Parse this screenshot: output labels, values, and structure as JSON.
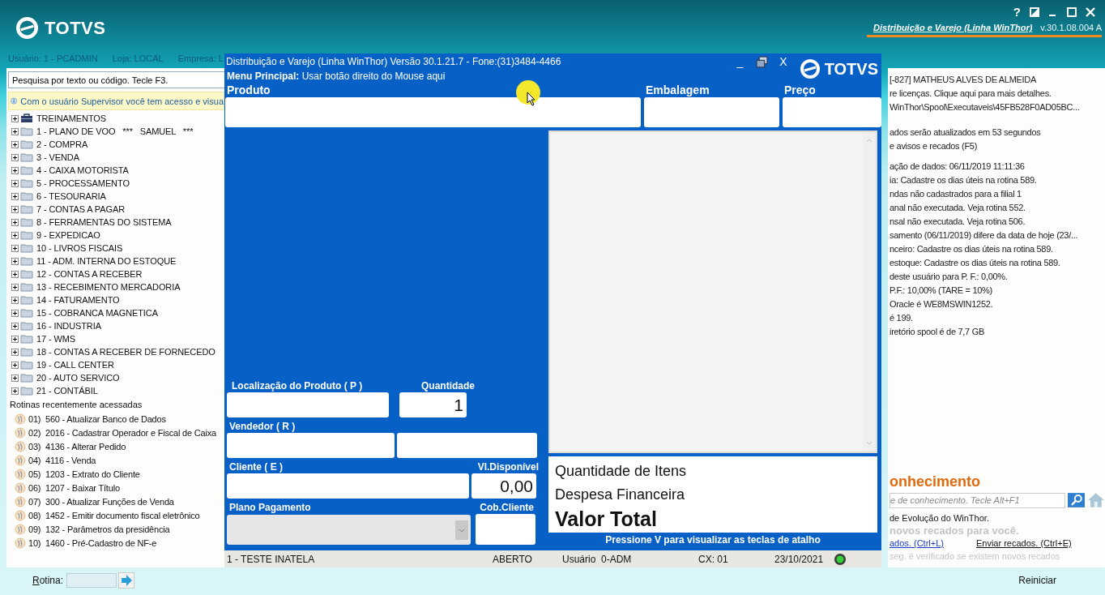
{
  "app_header": {
    "logo": "TOTVS",
    "help": "?",
    "product_link": "Distribuição e Varejo (Linha WinThor)",
    "version": "v.30.1.08.004 A"
  },
  "session_bar": [
    "Usuário: 1 - PCADMIN",
    "Loja: LOCAL",
    "Empresa: L"
  ],
  "menu_panel": {
    "search": {
      "placeholder": "Pesquisa por texto ou código. Tecle F3."
    },
    "notice": "Com o usuário Supervisor você tem acesso e visua",
    "tree": [
      {
        "label": "TREINAMENTOS",
        "kind": "briefcase",
        "expanded": false
      },
      {
        "label": "1 - PLANO DE VOO   ***   SAMUEL   ***",
        "kind": "folder",
        "expanded": false
      },
      {
        "label": "2 - COMPRA",
        "kind": "folder",
        "expanded": false
      },
      {
        "label": "3 - VENDA",
        "kind": "folder",
        "expanded": false
      },
      {
        "label": "4 - CAIXA MOTORISTA",
        "kind": "folder",
        "expanded": false
      },
      {
        "label": "5 - PROCESSAMENTO",
        "kind": "folder",
        "expanded": false
      },
      {
        "label": "6 - TESOURARIA",
        "kind": "folder",
        "expanded": false
      },
      {
        "label": "7 - CONTAS A PAGAR",
        "kind": "folder",
        "expanded": false
      },
      {
        "label": "8 - FERRAMENTAS DO SISTEMA",
        "kind": "folder",
        "expanded": false
      },
      {
        "label": "9 - EXPEDICAO",
        "kind": "folder",
        "expanded": false
      },
      {
        "label": "10 - LIVROS FISCAIS",
        "kind": "folder",
        "expanded": false
      },
      {
        "label": "11 - ADM. INTERNA DO ESTOQUE",
        "kind": "folder",
        "expanded": false
      },
      {
        "label": "12 - CONTAS A RECEBER",
        "kind": "folder",
        "expanded": false
      },
      {
        "label": "13 - RECEBIMENTO MERCADORIA",
        "kind": "folder",
        "expanded": false
      },
      {
        "label": "14 - FATURAMENTO",
        "kind": "folder",
        "expanded": false
      },
      {
        "label": "15 - COBRANCA MAGNETICA",
        "kind": "folder",
        "expanded": false
      },
      {
        "label": "16 - INDUSTRIA",
        "kind": "folder",
        "expanded": false
      },
      {
        "label": "17 - WMS",
        "kind": "folder",
        "expanded": false
      },
      {
        "label": "18 - CONTAS A RECEBER DE FORNECEDO",
        "kind": "folder",
        "expanded": false
      },
      {
        "label": "19 - CALL CENTER",
        "kind": "folder",
        "expanded": false
      },
      {
        "label": "20 - AUTO SERVICO",
        "kind": "folder",
        "expanded": false
      },
      {
        "label": "21 - CONTÁBIL",
        "kind": "folder",
        "expanded": false
      }
    ],
    "recent_title": "Rotinas recentemente acessadas",
    "recent": [
      "01)  560 - Atualizar Banco de Dados",
      "02)  2016 - Cadastrar Operador e Fiscal de Caixa",
      "03)  4136 - Alterar Pedido",
      "04)  4116 - Venda",
      "05)  1203 - Extrato do Cliente",
      "06)  1207 - Baixar Título",
      "07)  300 - Atualizar Funções de Venda",
      "08)  1452 - Emitir documento fiscal eletrônico",
      "09)  132 - Parâmetros da presidência",
      "10)  1460 - Pré-Cadastro de NF-e"
    ]
  },
  "info_panel": {
    "message_groups": [
      [
        "[-827] MATHEUS ALVES DE ALMEIDA",
        "re licenças. Clique aqui para mais detalhes.",
        "WinThor\\Spool\\Executaveis\\45FB528F0AD05BC..."
      ],
      [
        "ados serão atualizados em 53 segundos",
        "e avisos e recados (F5)"
      ],
      [
        "ação de dados: 06/11/2019 11:11:36",
        "ia: Cadastre os dias úteis na rotina 589.",
        "ndas não cadastrados para a filial 1",
        "anal não executada. Veja rotina 552.",
        "nsal não executada. Veja rotina 506.",
        "samento (06/11/2019) difere da data de hoje (23/...",
        "nceiro: Cadastre os dias úteis na rotina 589.",
        "estoque: Cadastre os dias úteis na rotina 589.",
        "deste usuário para P. F.: 0,00%.",
        "P.F.: 10,00% (TARE = 10%)",
        "Oracle é WE8MSWIN1252.",
        "é 199.",
        "iretório spool é de 7,7 GB"
      ]
    ],
    "knowledge_title": "onhecimento",
    "knowledge_search": {
      "placeholder": "e de conhecimento. Tecle Alt+F1"
    },
    "evolution": "de Evolução do WinThor.",
    "new_messages": "novos recados para você.",
    "links": [
      "ados. (Ctrl+L)",
      "Enviar recados. (Ctrl+E)"
    ],
    "note": "seg. é verificado se existem novos recados"
  },
  "bottom_bar": {
    "routine_label": "Rotina:",
    "restart": "Reiniciar"
  },
  "dialog": {
    "title": "Distribuição e Varejo (Linha WinThor) Versão 30.1.21.7 - Fone:(31)3484-4466",
    "minimize": "_",
    "close": "X",
    "logo": "TOTVS",
    "menu_hint": "**Menu Principal:** Usar botão direito do Mouse aqui",
    "product_fields": [
      "Produto",
      "Embalagem",
      "Preço"
    ],
    "location_label": "Localização do Produto ( P )",
    "quantity": {
      "label": "Quantidade",
      "value": "1"
    },
    "seller_label": "Vendedor ( R )",
    "client_label": "Cliente ( E )",
    "available": {
      "label": "Vl.Disponível",
      "value": "0,00"
    },
    "payment_plan": {
      "label": "Plano Pagamento",
      "disabled": true
    },
    "client_charge_label": "Cob.Cliente",
    "totals": [
      {
        "label": "Quantidade de Itens",
        "kind": "normal"
      },
      {
        "label": "Despesa Financeira",
        "kind": "normal"
      },
      {
        "label": "Valor Total",
        "kind": "grand"
      }
    ],
    "shortcut_hint": "Pressione V para visualizar as teclas de atalho",
    "status": [
      "1 - TESTE INATELA",
      "ABERTO",
      "Usuário  0-ADM",
      "CX: 01",
      "23/10/2021"
    ]
  }
}
